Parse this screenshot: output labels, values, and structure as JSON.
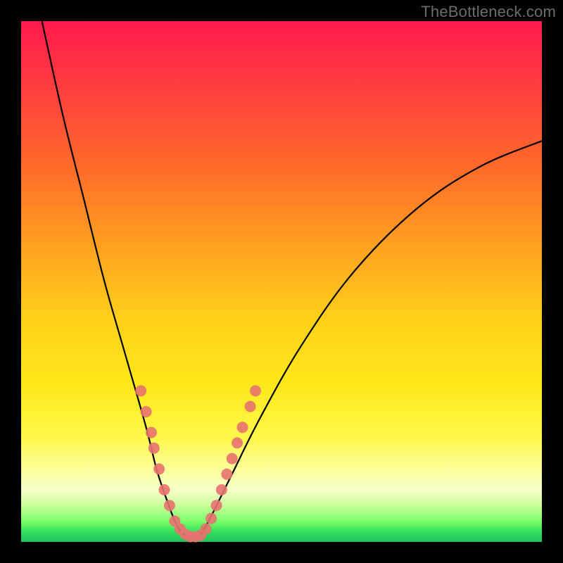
{
  "watermark": "TheBottleneck.com",
  "chart_data": {
    "type": "line",
    "title": "",
    "xlabel": "",
    "ylabel": "",
    "xlim": [
      0,
      100
    ],
    "ylim": [
      0,
      100
    ],
    "grid": false,
    "curves": {
      "left": [
        {
          "x": 4,
          "y": 100
        },
        {
          "x": 8,
          "y": 82
        },
        {
          "x": 12,
          "y": 66
        },
        {
          "x": 16,
          "y": 50
        },
        {
          "x": 20,
          "y": 36
        },
        {
          "x": 24,
          "y": 22
        },
        {
          "x": 26,
          "y": 14
        },
        {
          "x": 28,
          "y": 8
        },
        {
          "x": 30,
          "y": 3
        },
        {
          "x": 32,
          "y": 1
        }
      ],
      "right": [
        {
          "x": 34,
          "y": 1
        },
        {
          "x": 36,
          "y": 4
        },
        {
          "x": 40,
          "y": 12
        },
        {
          "x": 46,
          "y": 24
        },
        {
          "x": 54,
          "y": 38
        },
        {
          "x": 64,
          "y": 52
        },
        {
          "x": 76,
          "y": 64
        },
        {
          "x": 88,
          "y": 72
        },
        {
          "x": 100,
          "y": 77
        }
      ]
    },
    "scatter_points": [
      {
        "x": 23,
        "y": 29
      },
      {
        "x": 24,
        "y": 25
      },
      {
        "x": 25,
        "y": 21
      },
      {
        "x": 25.5,
        "y": 18
      },
      {
        "x": 26.5,
        "y": 14
      },
      {
        "x": 27.5,
        "y": 10
      },
      {
        "x": 28.5,
        "y": 7
      },
      {
        "x": 29.5,
        "y": 4
      },
      {
        "x": 30.5,
        "y": 2.5
      },
      {
        "x": 31.5,
        "y": 1.5
      },
      {
        "x": 32.5,
        "y": 1
      },
      {
        "x": 33.5,
        "y": 1
      },
      {
        "x": 34.5,
        "y": 1.3
      },
      {
        "x": 35.5,
        "y": 2.5
      },
      {
        "x": 36.5,
        "y": 4.5
      },
      {
        "x": 37.5,
        "y": 7
      },
      {
        "x": 38.5,
        "y": 10
      },
      {
        "x": 39.5,
        "y": 13
      },
      {
        "x": 40.5,
        "y": 16
      },
      {
        "x": 41.5,
        "y": 19
      },
      {
        "x": 42.5,
        "y": 22
      },
      {
        "x": 44,
        "y": 26
      },
      {
        "x": 45,
        "y": 29
      }
    ],
    "colors": {
      "curve": "#000000",
      "points": "#e8726f",
      "background_top": "#ff1a4d",
      "background_bottom": "#1fc25c"
    }
  }
}
